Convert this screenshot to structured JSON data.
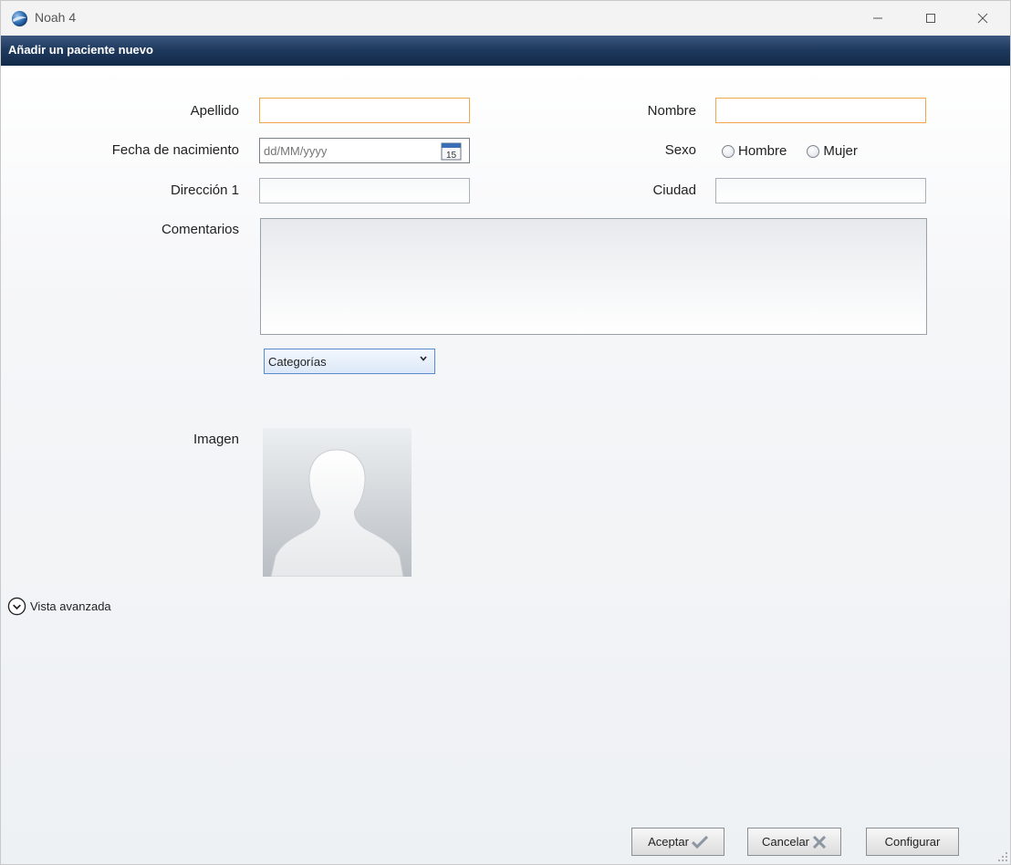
{
  "window": {
    "title": "Noah 4"
  },
  "header": {
    "title": "Añadir un paciente nuevo"
  },
  "form": {
    "last_name": {
      "label": "Apellido",
      "value": ""
    },
    "first_name": {
      "label": "Nombre",
      "value": ""
    },
    "birth_date": {
      "label": "Fecha de nacimiento",
      "placeholder": "dd/MM/yyyy"
    },
    "sex": {
      "label": "Sexo",
      "options": [
        "Hombre",
        "Mujer"
      ]
    },
    "address": {
      "label": "Dirección 1",
      "value": ""
    },
    "city": {
      "label": "Ciudad",
      "value": ""
    },
    "comments": {
      "label": "Comentarios",
      "value": ""
    },
    "categories": {
      "selected": "Categorías"
    },
    "image": {
      "label": "Imagen"
    }
  },
  "advanced_view": {
    "label": "Vista avanzada"
  },
  "buttons": {
    "accept": "Aceptar",
    "cancel": "Cancelar",
    "configure": "Configurar"
  },
  "colors": {
    "header_band": "#1f3a5f",
    "required_border": "#f0a64a",
    "dropdown_border": "#5a8bd0"
  }
}
